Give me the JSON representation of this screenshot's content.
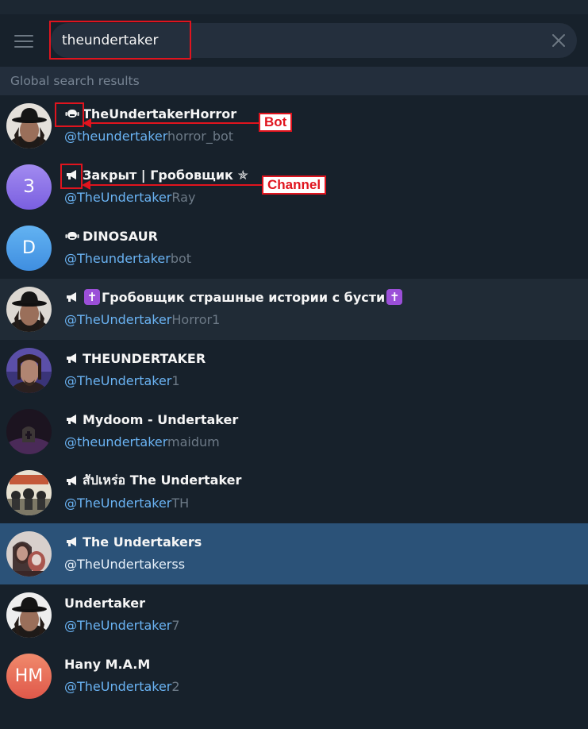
{
  "search": {
    "query": "theundertaker"
  },
  "section_title": "Global search results",
  "results": [
    {
      "name": "TheUndertakerHorror",
      "type": "bot",
      "handle_match": "@theundertaker",
      "handle_rest": "horror_bot",
      "avatar": "photo"
    },
    {
      "name": "Закрыт | Гробовщик ✯",
      "type": "channel",
      "handle_match": "@TheUndertaker",
      "handle_rest": "Ray",
      "avatar_letter": "З",
      "avatar_color": "#8c6ee6"
    },
    {
      "name": "DINOSAUR",
      "type": "bot",
      "handle_match": "@Theundertaker",
      "handle_rest": "bot",
      "avatar_letter": "D",
      "avatar_color": "#4f9fe8"
    },
    {
      "name_pre": "✝",
      "name": "Гробовщик страшные истории с бусти",
      "name_post": "✝",
      "type": "channel",
      "handle_match": "@TheUndertaker",
      "handle_rest": "Horror1",
      "avatar": "photo"
    },
    {
      "name": "THEUNDERTAKER",
      "type": "channel",
      "handle_match": "@TheUndertaker",
      "handle_rest": "1",
      "avatar": "photo"
    },
    {
      "name": "Mydoom - Undertaker",
      "type": "channel",
      "handle_match": "@theundertaker",
      "handle_rest": "maidum",
      "avatar": "photo"
    },
    {
      "name": "สัปเหร่อ The Undertaker",
      "type": "channel",
      "handle_match": "@TheUndertaker",
      "handle_rest": "TH",
      "avatar": "photo"
    },
    {
      "name": "The Undertakers",
      "type": "channel",
      "handle_match": "@TheUndertakers",
      "handle_rest": "s",
      "avatar": "photo"
    },
    {
      "name": "Undertaker",
      "type": "user",
      "handle_match": "@TheUndertaker",
      "handle_rest": "7",
      "avatar": "photo"
    },
    {
      "name": "Hany M.A.M",
      "type": "user",
      "handle_match": "@TheUndertaker",
      "handle_rest": "2",
      "avatar_letter": "HM",
      "avatar_color": "#e8624f"
    }
  ],
  "annotations": {
    "bot": "Bot",
    "channel": "Channel"
  },
  "colors": {
    "background": "#17212b",
    "accent": "#6ab3f3",
    "selected": "#2b5278",
    "annotation": "#e0141e"
  }
}
